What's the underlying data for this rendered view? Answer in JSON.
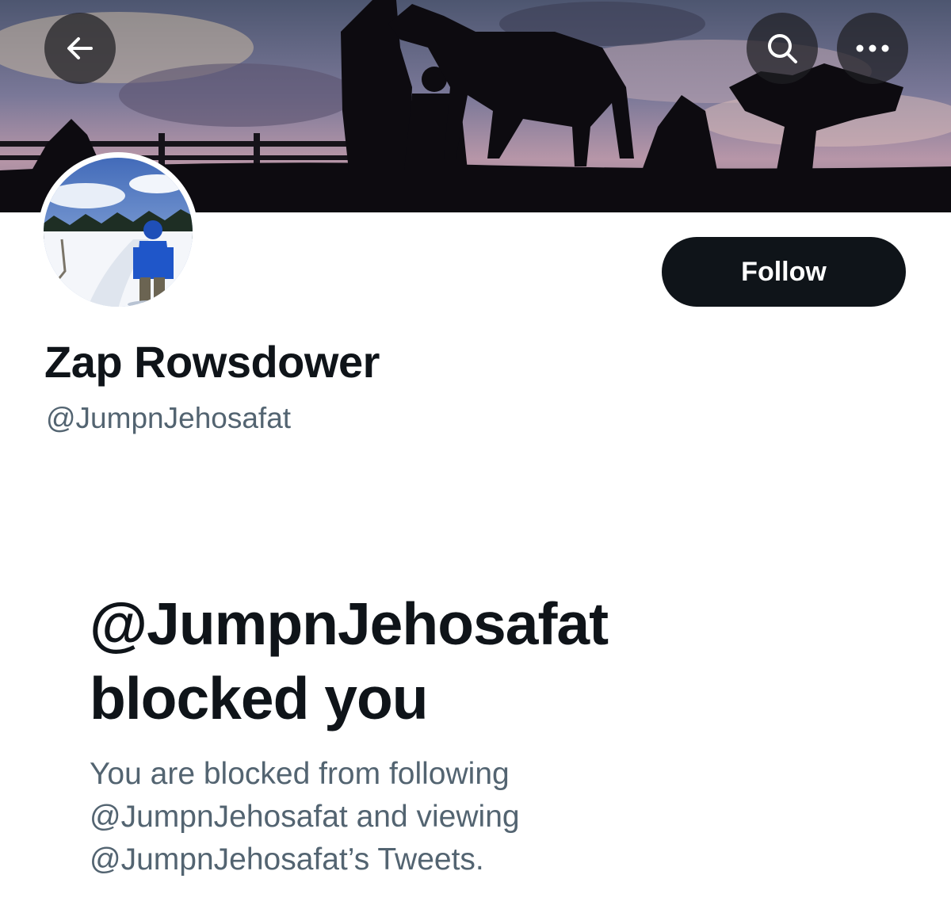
{
  "header": {
    "back_icon": "arrow-left-icon",
    "search_icon": "search-icon",
    "more_icon": "more-horizontal-icon"
  },
  "profile": {
    "display_name": "Zap Rowsdower",
    "handle": "@JumpnJehosafat",
    "follow_label": "Follow"
  },
  "blocked": {
    "title": "@JumpnJehosafat blocked you",
    "description": "You are blocked from following @JumpnJehosafat and viewing @JumpnJehosafat’s Tweets."
  },
  "colors": {
    "text_primary": "#0f1419",
    "text_secondary": "#536471",
    "button_bg": "#0f1419",
    "overlay_button": "#1e1e22"
  }
}
